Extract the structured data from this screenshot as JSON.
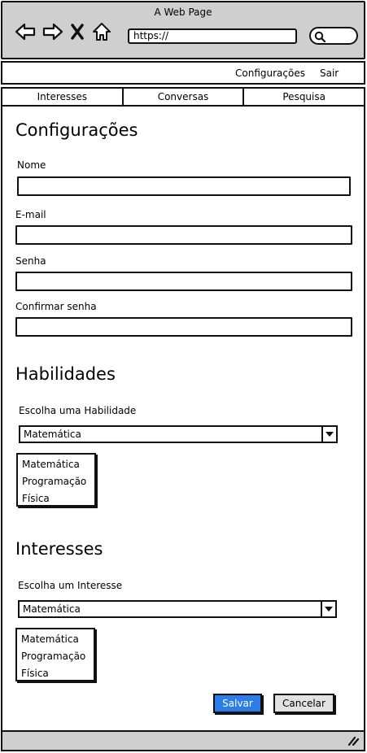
{
  "browser": {
    "title": "A Web Page",
    "url": "https://",
    "icons": [
      "back-icon",
      "forward-icon",
      "close-icon",
      "home-icon",
      "search-icon"
    ]
  },
  "topmenu": {
    "settings": "Configurações",
    "logout": "Sair"
  },
  "tabs": [
    "Interesses",
    "Conversas",
    "Pesquisa"
  ],
  "settings": {
    "title": "Configurações",
    "name_label": "Nome",
    "name_value": "",
    "email_label": "E-mail",
    "email_value": "",
    "password_label": "Senha",
    "password_value": "",
    "confirm_label": "Confirmar senha",
    "confirm_value": ""
  },
  "skills": {
    "title": "Habilidades",
    "choose_label": "Escolha uma Habilidade",
    "selected": "Matemática",
    "options": [
      "Matemática",
      "Programação",
      "Física"
    ]
  },
  "interests": {
    "title": "Interesses",
    "choose_label": "Escolha um Interesse",
    "selected": "Matemática",
    "options": [
      "Matemática",
      "Programação",
      "Física"
    ]
  },
  "actions": {
    "save": "Salvar",
    "cancel": "Cancelar"
  },
  "colors": {
    "chrome": "#cfcfcf",
    "save_button": "#2b7de9",
    "cancel_button": "#e2e2e2"
  }
}
